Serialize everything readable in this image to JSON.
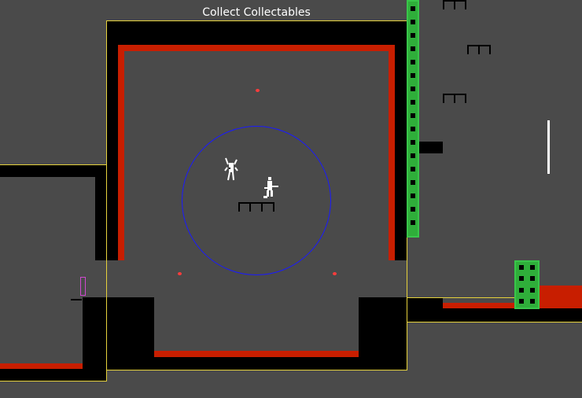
{
  "level": {
    "title": "Collect Collectables"
  },
  "colors": {
    "background": "#4a4a4a",
    "wall": "#000000",
    "hazard": "#c81e00",
    "room_border": "#e6d23c",
    "ladder": "#2fae3a",
    "collectable": "#ff3c3c",
    "radius": "#1a1aff",
    "marker": "#d04ad0"
  },
  "entities": {
    "player": "player-sprite",
    "enemy": "enemy-sprite",
    "collectables": [
      "collectable-1",
      "collectable-2",
      "collectable-3"
    ]
  }
}
